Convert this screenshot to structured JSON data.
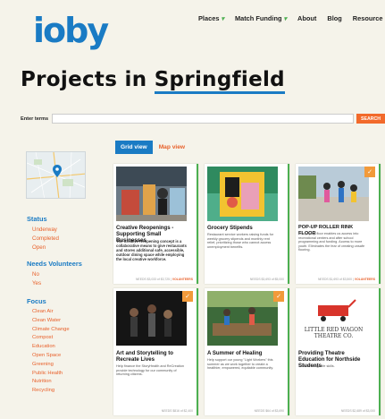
{
  "header": {
    "logo": "ioby",
    "nav": [
      {
        "label": "Places",
        "dropdown": true
      },
      {
        "label": "Match Funding",
        "dropdown": true
      },
      {
        "label": "About",
        "dropdown": false
      },
      {
        "label": "Blog",
        "dropdown": false
      },
      {
        "label": "Resource",
        "dropdown": false
      }
    ]
  },
  "page": {
    "title_prefix": "Projects in",
    "title_city": "Springfield"
  },
  "search": {
    "label": "Enter terms",
    "placeholder": "",
    "value": "",
    "button": "SEARCH"
  },
  "view_tabs": {
    "grid": "Grid view",
    "map": "Map view"
  },
  "filters": {
    "status": {
      "heading": "Status",
      "items": [
        "Underway",
        "Completed",
        "Open"
      ]
    },
    "volunteers": {
      "heading": "Needs Volunteers",
      "items": [
        "No",
        "Yes"
      ]
    },
    "focus": {
      "heading": "Focus",
      "items": [
        "Clean Air",
        "Clean Water",
        "Climate Change",
        "Compost",
        "Education",
        "Open Space",
        "Greening",
        "Public Health",
        "Nutrition",
        "Recycling"
      ]
    }
  },
  "cards": [
    {
      "title": "Creative Reopenings - Supporting Small Businesses",
      "desc": "The Creative Reopening concept is a collaborative means to give restaurants and stores additional safe, accessible, outdoor dining space while employing the local creative workforce.",
      "footer": "NEEDS $3,033 of $3,725",
      "volunteer": "VOLUNTEERS"
    },
    {
      "title": "Grocery Stipends",
      "desc": "Restaurant service workers raising funds for weekly grocery stipends and monthly rent relief, prioritizing those who cannot access unemployment benefits.",
      "footer": "NEEDS $3,693 of $5,000",
      "volunteer": ""
    },
    {
      "title": "POP-UP ROLLER RINK FLOOR",
      "desc": "The pop-up floor enables us access into recreational centers and after school programming and funding. Access to more youth. Eliminates the fear of creating unsafe flooring.",
      "footer": "NEEDS $1,693 of $3,500",
      "volunteer": "VOLUNTEERS"
    },
    {
      "title": "Art and Storytelling to Recreate Lives",
      "desc": "Help finance the StoryHealth and ReCreation provide technology for our community of returning citizens.",
      "footer": "NEEDS $816 of $2,400",
      "volunteer": ""
    },
    {
      "title": "A Summer of Healing",
      "desc": "Help support our young \"Light Workers\" this summer as we work together to create a healthier, empowered, equitable community.",
      "footer": "NEEDS $64 of $3,690",
      "volunteer": ""
    },
    {
      "title": "Providing Theatre Education for Northside Students",
      "desc": "Theatre brings life skills.",
      "footer": "NEEDS $2,689 of $3,000",
      "volunteer": "",
      "logo_line1": "LITTLE RED WAGON",
      "logo_line2": "THEATRE CO."
    }
  ],
  "colors": {
    "brand": "#1a7bc4",
    "accent": "#e8602a",
    "green": "#4caf50",
    "bg": "#f5f3ea"
  }
}
